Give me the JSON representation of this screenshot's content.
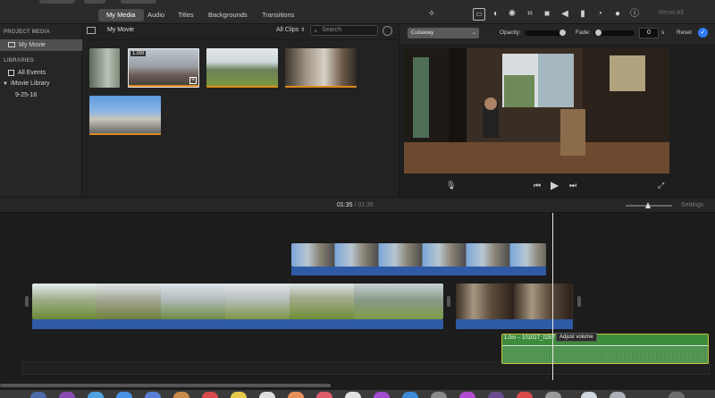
{
  "media_tabs": [
    "My Media",
    "Audio",
    "Titles",
    "Backgrounds",
    "Transitions"
  ],
  "active_tab": "My Media",
  "toolbar_icons": [
    "magic-wand-icon",
    "crop-to-fill-icon",
    "color-balance-icon",
    "color-palette-icon",
    "crop-icon",
    "stabilization-icon",
    "volume-icon",
    "equalizer-icon",
    "speed-icon",
    "noise-filter-icon",
    "info-icon"
  ],
  "reset_all_label": "Reset All",
  "sidebar": {
    "project_media_heading": "PROJECT MEDIA",
    "project_item": "My Movie",
    "libraries_heading": "LIBRARIES",
    "all_events": "All Events",
    "library": "iMovie Library",
    "event": "9-25-18"
  },
  "browser": {
    "title": "My Movie",
    "filter": "All Clips",
    "search_placeholder": "Search",
    "thumb_duration": "1.0m"
  },
  "viewer": {
    "overlay_mode": "Cutaway",
    "opacity_label": "Opacity:",
    "fade_label": "Fade:",
    "fade_value": "0",
    "fade_unit": "s",
    "reset_label": "Reset"
  },
  "timeline": {
    "current_time": "01:35",
    "separator": "/",
    "total_time": "01:35",
    "settings_label": "Settings",
    "audio_clip_title": "1.0m – 101027_0257",
    "tooltip": "Adjust volume"
  },
  "colors": {
    "accent_orange": "#e08a1e",
    "audio_blue": "#2f5aa6",
    "audio_green": "#3c8c3c",
    "highlight_blue": "#2f7bf6"
  }
}
